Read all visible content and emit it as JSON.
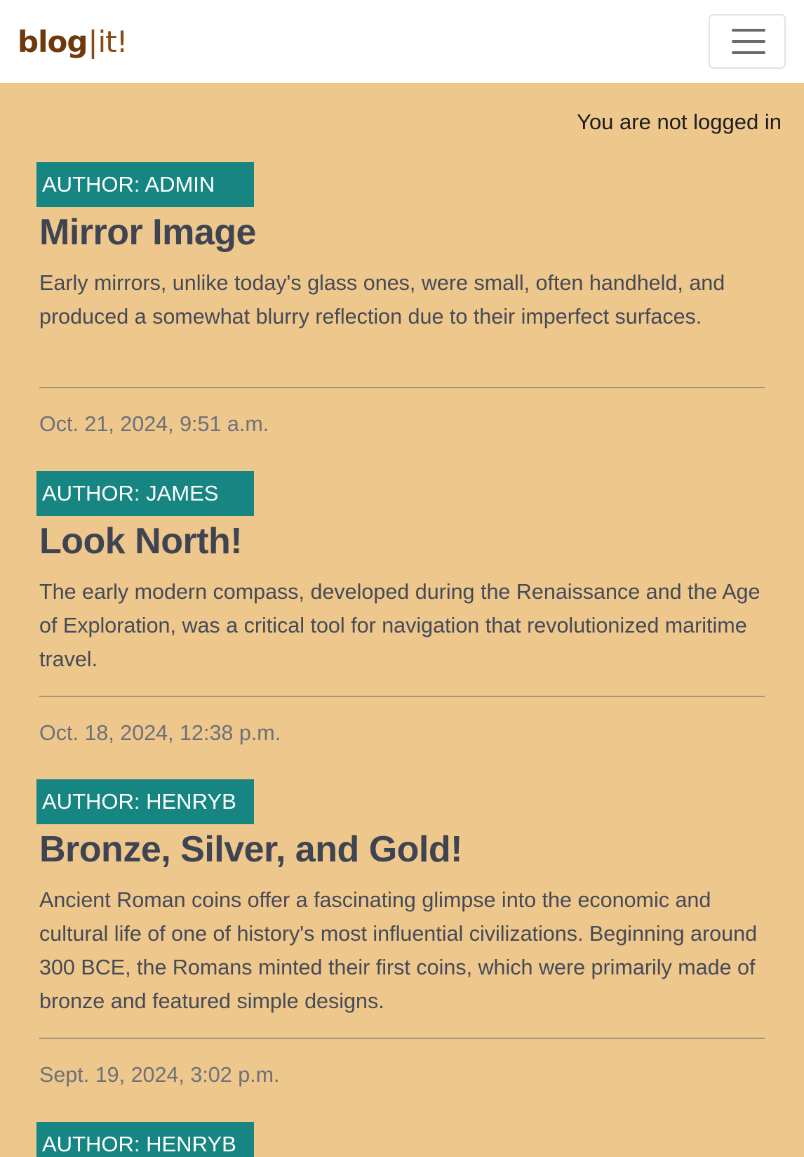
{
  "brand": {
    "part1": "blog",
    "separator": "|",
    "part2": "it!"
  },
  "nav": {
    "toggle_icon": "hamburger-menu-icon"
  },
  "login_status": "You are not logged in",
  "posts": [
    {
      "author": "AUTHOR: ADMIN",
      "title": "Mirror Image",
      "excerpt": "Early mirrors, unlike today's glass ones, were small, often handheld, and produced a somewhat blurry reflection due to their imperfect surfaces.",
      "date": "Oct. 21, 2024, 9:51 a.m."
    },
    {
      "author": "AUTHOR: JAMES",
      "title": "Look North!",
      "excerpt": "The early modern compass, developed during the Renaissance and the Age of Exploration, was a critical tool for navigation that revolutionized maritime travel.",
      "date": "Oct. 18, 2024, 12:38 p.m."
    },
    {
      "author": "AUTHOR: HENRYB",
      "title": "Bronze, Silver, and Gold!",
      "excerpt": "Ancient Roman coins offer a fascinating glimpse into the economic and cultural life of one of history's most influential civilizations. Beginning around 300 BCE, the Romans minted their first coins, which were primarily made of bronze and featured simple designs.",
      "date": "Sept. 19, 2024, 3:02 p.m."
    },
    {
      "author": "AUTHOR: HENRYB"
    }
  ],
  "colors": {
    "page_background": "#eec78c",
    "navbar_background": "#ffffff",
    "author_badge": "#178582",
    "brand": "#6e3a0d",
    "title_text": "#3f4452"
  }
}
